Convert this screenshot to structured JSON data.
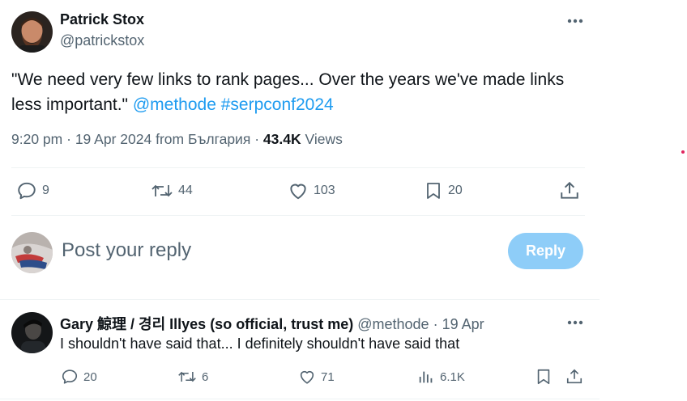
{
  "tweet": {
    "author_name": "Patrick Stox",
    "author_handle": "@patrickstox",
    "text_plain": "\"We need very few links to rank pages... Over the years we've made links less important.\"",
    "mention": "@methode",
    "hashtag": "#serpconf2024",
    "time": "9:20 pm",
    "date": "19 Apr 2024",
    "from_prefix": "from",
    "location": "България",
    "views_count": "43.4K",
    "views_label": "Views",
    "replies": "9",
    "retweets": "44",
    "likes": "103",
    "bookmarks": "20"
  },
  "compose": {
    "placeholder": "Post your reply",
    "button_label": "Reply"
  },
  "reply": {
    "author_name": "Gary 鯨理 / 경리 Illyes (so official, trust me)",
    "author_handle": "@methode",
    "date": "19 Apr",
    "text": "I shouldn't have said that... I definitely shouldn't have said that",
    "replies": "20",
    "retweets": "6",
    "likes": "71",
    "views": "6.1K"
  },
  "colors": {
    "accent": "#1d9bf0",
    "reply_button_disabled": "#8ecdf8",
    "secondary_text": "#536471",
    "primary_text": "#0f1419",
    "divider": "#eff3f4"
  },
  "icons": {
    "more": "more-horizontal-icon",
    "reply": "reply-bubble-icon",
    "retweet": "retweet-icon",
    "like": "heart-icon",
    "bookmark": "bookmark-icon",
    "share": "share-icon",
    "views": "views-bar-chart-icon"
  }
}
